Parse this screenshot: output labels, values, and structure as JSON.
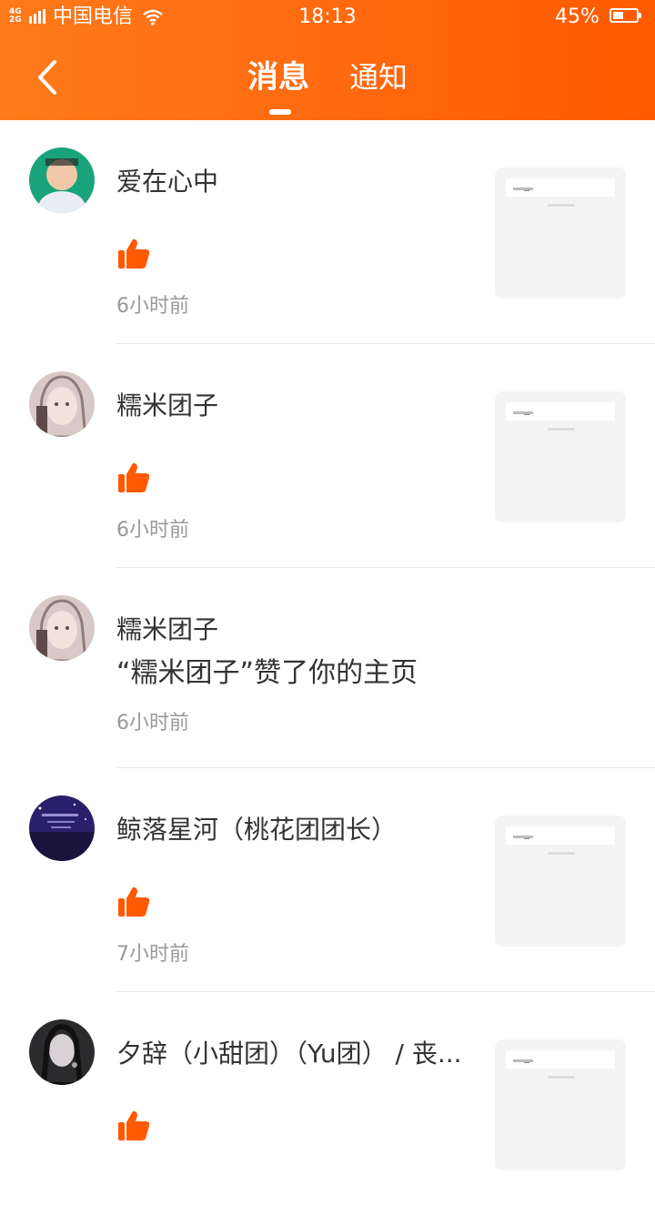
{
  "status_bar": {
    "network_top": "4G",
    "network_bottom": "2G",
    "carrier": "中国电信",
    "time": "18:13",
    "battery": "45%"
  },
  "header": {
    "tabs": [
      {
        "label": "消息",
        "active": true
      },
      {
        "label": "通知",
        "active": false
      }
    ]
  },
  "items": [
    {
      "name": "爱在心中",
      "kind": "like",
      "time": "6小时前",
      "has_preview": true
    },
    {
      "name": "糯米团子",
      "kind": "like",
      "time": "6小时前",
      "has_preview": true
    },
    {
      "name": "糯米团子",
      "kind": "text",
      "message": "“糯米团子”赞了你的主页",
      "time": "6小时前",
      "has_preview": false
    },
    {
      "name": "鲸落星河（桃花团团长）",
      "kind": "like",
      "time": "7小时前",
      "has_preview": true
    },
    {
      "name": "夕辞（小甜团）（Yu团） / 丧...",
      "kind": "like",
      "time": "",
      "has_preview": true
    }
  ],
  "colors": {
    "accent": "#ff5a00",
    "like_icon": "#ff5a00"
  }
}
